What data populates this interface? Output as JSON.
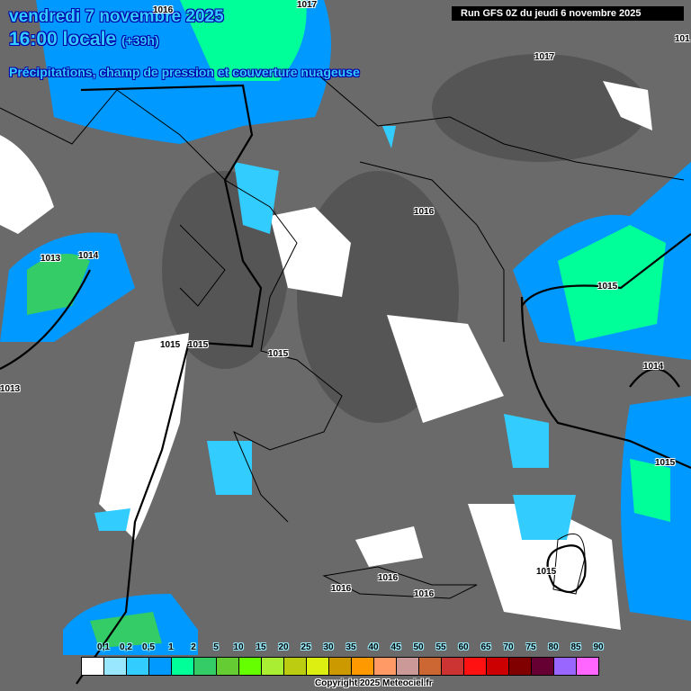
{
  "header": {
    "date": "vendredi 7 novembre 2025",
    "time": "16:00 locale",
    "lead": "(+39h)",
    "subtitle": "Précipitations, champ de pression et couverture nuageuse",
    "run": "Run GFS 0Z du jeudi 6 novembre 2025"
  },
  "pressure_labels": [
    "1016",
    "1017",
    "1017",
    "101",
    "1016",
    "1013",
    "1014",
    "1015",
    "1015",
    "1015",
    "1015",
    "1014",
    "1013",
    "1015",
    "1015",
    "1016",
    "1016",
    "1016"
  ],
  "legend": {
    "labels": [
      "0,1",
      "0,2",
      "0,5",
      "1",
      "2",
      "5",
      "10",
      "15",
      "20",
      "25",
      "30",
      "35",
      "40",
      "45",
      "50",
      "55",
      "60",
      "65",
      "70",
      "75",
      "80",
      "85",
      "90"
    ],
    "colors": [
      "#ffffff",
      "#99e6ff",
      "#33ccff",
      "#0099ff",
      "#00ff99",
      "#33cc66",
      "#66cc33",
      "#66ff00",
      "#aaee33",
      "#bbcc11",
      "#ddee11",
      "#cc9900",
      "#ff9900",
      "#ff9966",
      "#cc9999",
      "#cc6633",
      "#cc3333",
      "#ff1111",
      "#cc0000",
      "#800000",
      "#660033",
      "#9966ff",
      "#ff66ff"
    ]
  },
  "copyright": "Copyright 2025 Meteociel.fr"
}
